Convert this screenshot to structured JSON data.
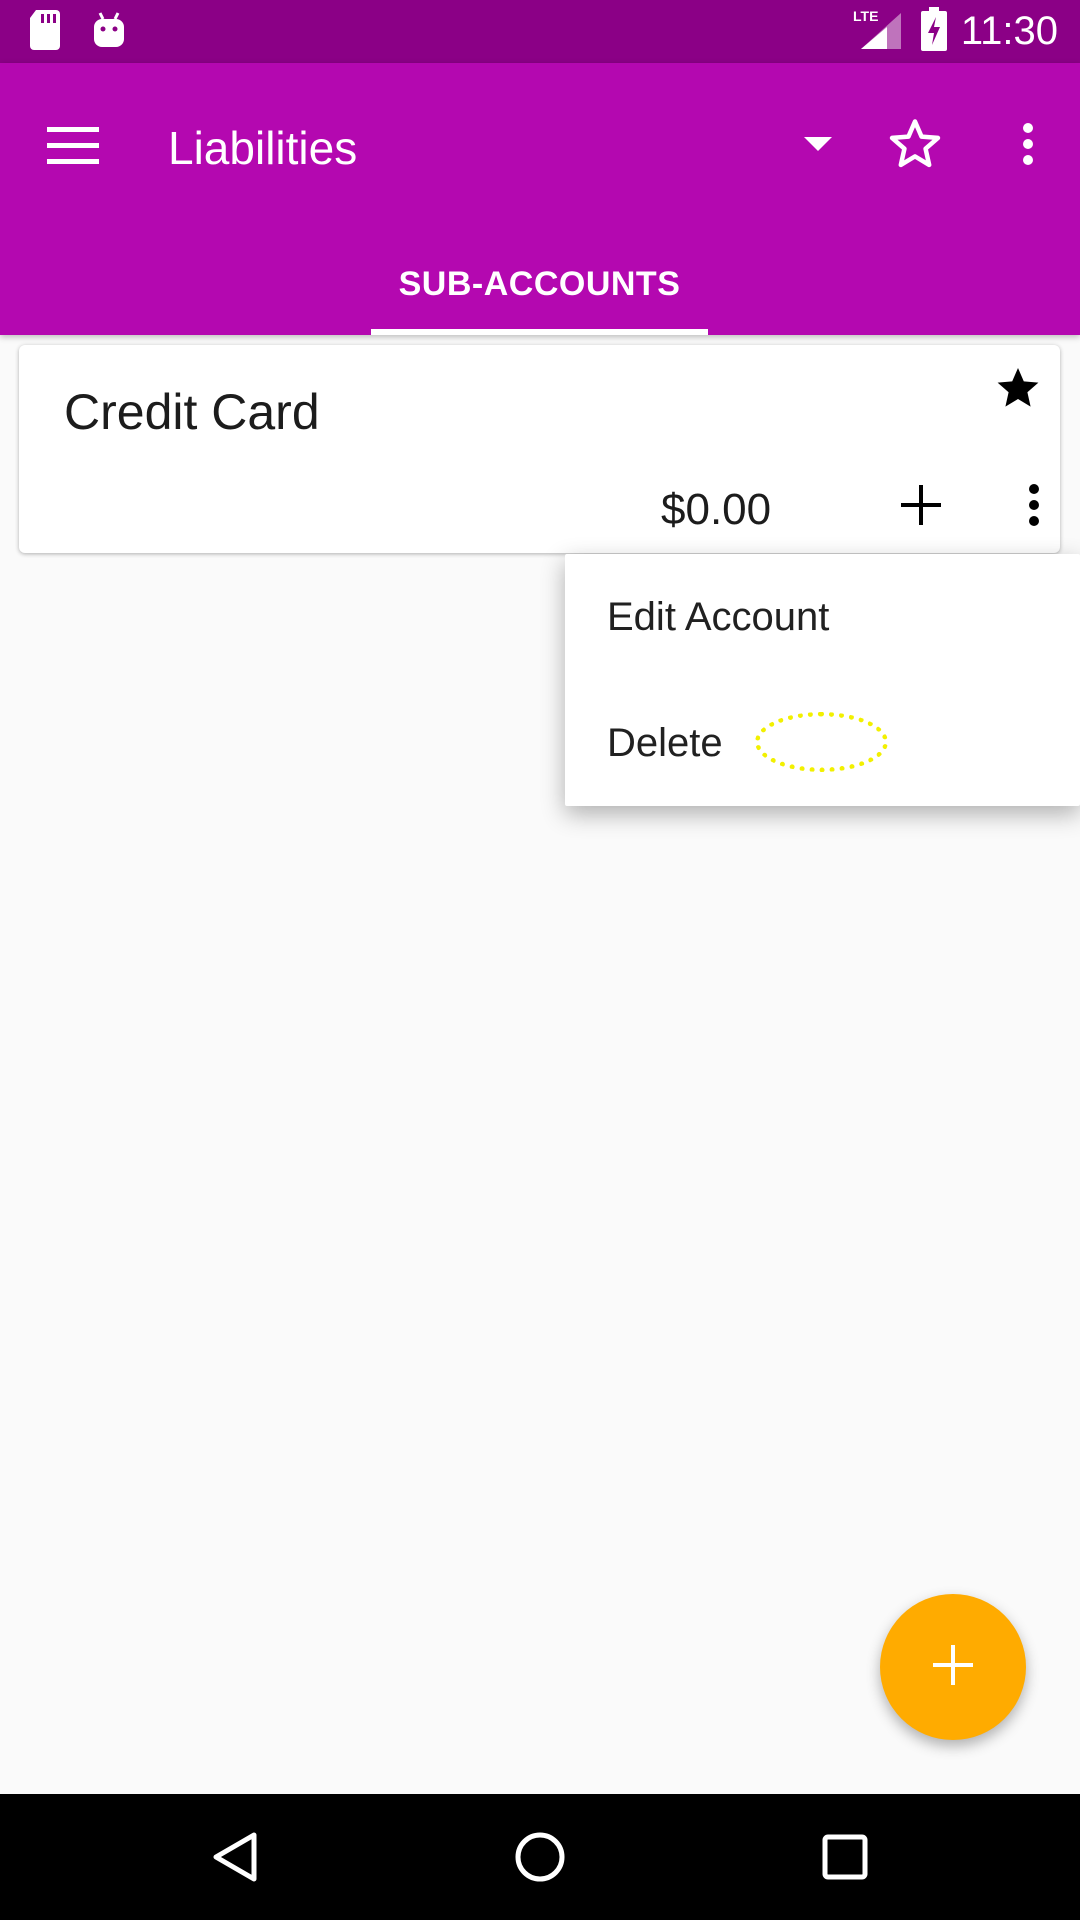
{
  "status_bar": {
    "time": "11:30",
    "network": "LTE",
    "icons": [
      "sd-card-icon",
      "android-icon",
      "signal-icon",
      "battery-charging-icon"
    ]
  },
  "app_bar": {
    "title": "Liabilities",
    "background": "#b408b0",
    "icons": [
      "hamburger-menu-icon",
      "dropdown-arrow-icon",
      "star-outline-icon",
      "overflow-menu-icon"
    ]
  },
  "tabs": [
    {
      "label": "SUB-ACCOUNTS",
      "selected": true
    }
  ],
  "accounts": [
    {
      "name": "Credit Card",
      "balance": "$0.00",
      "favorite": true
    }
  ],
  "popup_menu": {
    "items": [
      {
        "label": "Edit Account"
      },
      {
        "label": "Delete"
      }
    ]
  },
  "fab": {
    "icon": "plus-icon",
    "color": "#ffab00"
  },
  "nav_bar": {
    "icons": [
      "back-icon",
      "home-icon",
      "recents-icon"
    ]
  }
}
